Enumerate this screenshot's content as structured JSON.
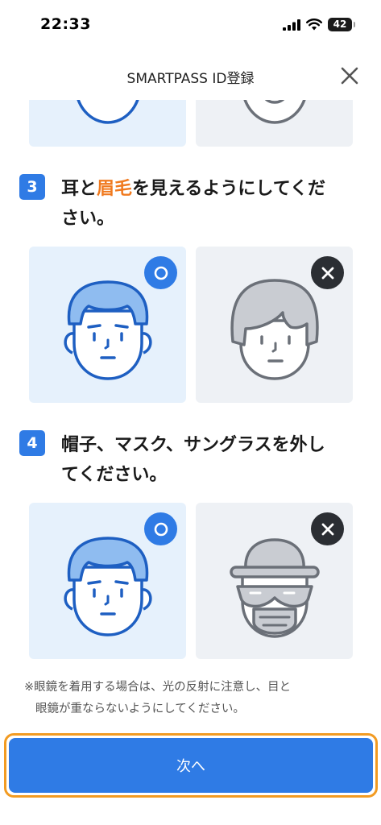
{
  "status_bar": {
    "time": "22:33",
    "battery": "42"
  },
  "header": {
    "title": "SMARTPASS ID登録"
  },
  "steps": [
    {
      "number": "3",
      "text_before": "耳と",
      "text_highlight": "眉毛",
      "text_line1_after": "を見えるようにしてくだ",
      "text_line2": "さい。"
    },
    {
      "number": "4",
      "text_line1": "帽子、マスク、サングラスを外し",
      "text_line2": "てください。"
    }
  ],
  "note": {
    "line1": "※眼鏡を着用する場合は、光の反射に注意し、目と",
    "line2": "眼鏡が重ならないようにしてください。"
  },
  "next_button": {
    "label": "次へ"
  },
  "colors": {
    "accent": "#2f7be5",
    "highlight": "#f07a1f",
    "good_bg": "#e6f1fc",
    "bad_bg": "#eef1f5",
    "focus_border": "#f29b22"
  },
  "icons": {
    "ok_mark": "circle-ok-icon",
    "ng_mark": "cross-ng-icon",
    "close": "close-icon"
  }
}
